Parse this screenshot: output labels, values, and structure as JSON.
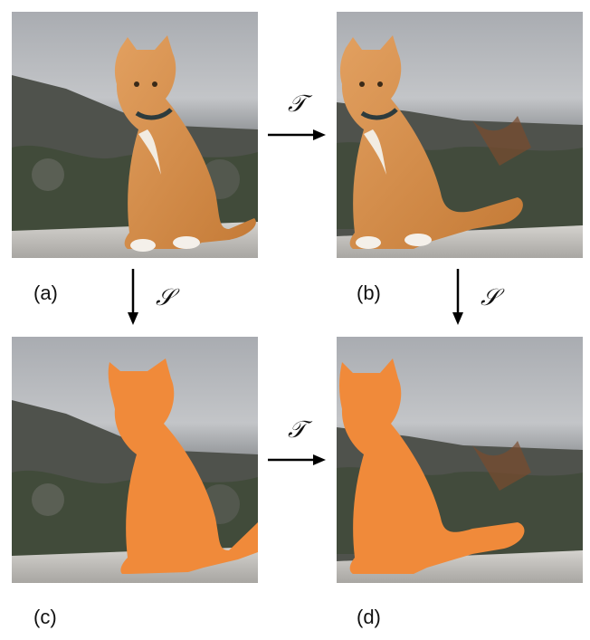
{
  "panels": [
    {
      "id": "a",
      "label": "(a)",
      "content": "photo of orange tabby kitten sitting on a log"
    },
    {
      "id": "b",
      "label": "(b)",
      "content": "transformed photo of the kitten"
    },
    {
      "id": "c",
      "label": "(c)",
      "content": "segmentation mask over kitten"
    },
    {
      "id": "d",
      "label": "(d)",
      "content": "segmentation mask over transformed kitten"
    }
  ],
  "operators": {
    "transform": "𝒯",
    "segment": "𝒮"
  },
  "colors": {
    "mask": "#f08a3a",
    "sky": "#b9bcc0",
    "hill": "#5a5d57",
    "log": "#c9c7c3",
    "cat": "#d98f4a",
    "arrow": "#000000"
  }
}
